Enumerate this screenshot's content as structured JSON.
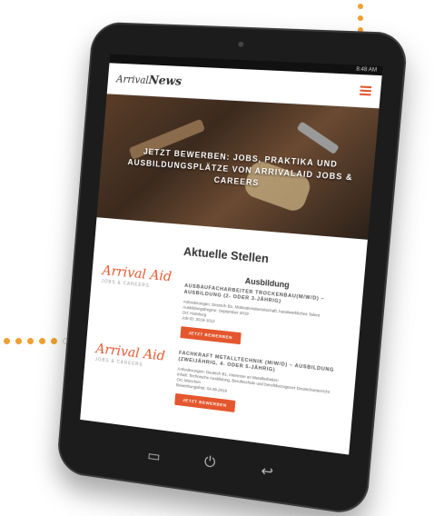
{
  "status_bar": {
    "time": "8:48 AM"
  },
  "header": {
    "logo_prefix": "Arrival",
    "logo_brand": "News"
  },
  "hero": {
    "text": "JETZT BEWERBEN: JOBS, PRAKTIKA UND AUSBILDUNGSPLÄTZE VON ARRIVALAID JOBS & CAREERS"
  },
  "main": {
    "heading": "Aktuelle Stellen"
  },
  "brand": {
    "name": "Arrival Aid",
    "tagline": "JOBS & CAREERS"
  },
  "jobs": [
    {
      "category": "Ausbildung",
      "title": "AUSBAUFACHARBEITER TROCKENBAU(M/W/D) – AUSBILDUNG (2- ODER 3-JÄHRIG)",
      "details": [
        "Anforderungen: Deutsch B1, Motivationsbereitschaft, handwerkliches Talent",
        "Ausbildungsbeginn: September 2019",
        "Ort: Hamburg",
        "Job-ID: 2019-1012"
      ],
      "cta": "JETZT BEWERBEN"
    },
    {
      "category": "",
      "title": "FACHKRAFT METALLTECHNIK (M/W/D) – AUSBILDUNG (ZWEIJÄHRIG, 4- ODER 5-JÄHRIG)",
      "details": [
        "Anforderungen: Deutsch B1, Interesse an Metallarbeiten",
        "Inhalt: Technische Ausbildung, Berufsschule und berufsbezogener Deutschunterricht",
        "Ort: München",
        "Bewerbungsfrist: 04.08.2019"
      ],
      "cta": "JETZT BEWERBEN"
    }
  ],
  "colors": {
    "accent": "#e4572e",
    "dots": "#f0a030",
    "bezel": "#1c1c1c"
  },
  "icons": {
    "menu": "hamburger-icon",
    "recent": "recent-apps-icon",
    "power": "power-icon",
    "back": "back-icon"
  }
}
